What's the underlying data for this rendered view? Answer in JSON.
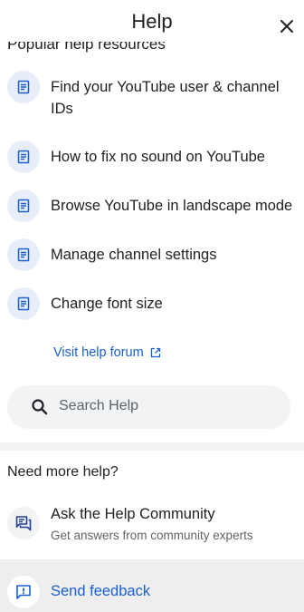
{
  "header": {
    "title": "Help",
    "close_icon": "close-icon"
  },
  "popular": {
    "heading": "Popular help resources",
    "articles": [
      {
        "label": "Find your YouTube user & channel IDs",
        "icon": "article-icon"
      },
      {
        "label": "How to fix no sound on YouTube",
        "icon": "article-icon"
      },
      {
        "label": "Browse YouTube in landscape mode",
        "icon": "article-icon"
      },
      {
        "label": "Manage channel settings",
        "icon": "article-icon"
      },
      {
        "label": "Change font size",
        "icon": "article-icon"
      }
    ],
    "visit_forum": "Visit help forum",
    "visit_forum_icon": "open-in-new-icon"
  },
  "search": {
    "placeholder": "Search Help",
    "icon": "search-icon"
  },
  "more_help": {
    "heading": "Need more help?",
    "community": {
      "title": "Ask the Help Community",
      "subtitle": "Get answers from community experts",
      "icon": "forum-icon"
    }
  },
  "feedback": {
    "label": "Send feedback",
    "icon": "feedback-icon"
  },
  "colors": {
    "link_blue": "#1a5fd0",
    "icon_blue": "#1a5fd0",
    "icon_circle": "#e8eef9",
    "search_bg": "#f1f3f4",
    "feedback_bg": "#eeeeee"
  }
}
